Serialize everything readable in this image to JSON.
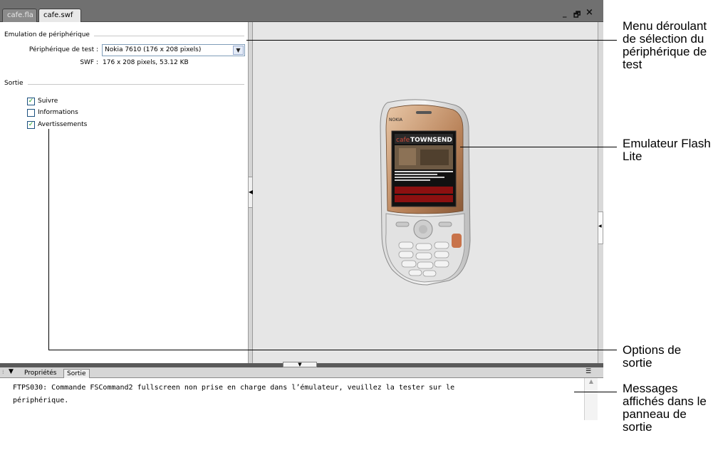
{
  "window": {
    "tabs": [
      {
        "label": "cafe.fla",
        "active": false
      },
      {
        "label": "cafe.swf",
        "active": true
      }
    ],
    "controls": {
      "minimize": "_",
      "restore": "🗗",
      "close": "×"
    }
  },
  "emulation": {
    "group_title": "Emulation de périphérique",
    "device_label": "Périphérique de test :",
    "device_value": "Nokia 7610 (176 x 208 pixels)",
    "swf_label": "SWF :",
    "swf_value": "176 x 208 pixels, 53.12 KB"
  },
  "output_options": {
    "group_title": "Sortie",
    "checkboxes": [
      {
        "label": "Suivre",
        "checked": true
      },
      {
        "label": "Informations",
        "checked": false
      },
      {
        "label": "Avertissements",
        "checked": true
      }
    ]
  },
  "phone": {
    "brand": "NOKIA",
    "screen_logo_a": "cafe",
    "screen_logo_b": "TOWNSEND"
  },
  "output_panel": {
    "tabs": [
      {
        "label": "Propriétés",
        "active": false
      },
      {
        "label": "Sortie",
        "active": true
      }
    ],
    "message": "FTPS030: Commande FSCommand2 fullscreen non prise en charge dans l’émulateur, veuillez la tester sur le\npériphérique."
  },
  "annotations": {
    "device_menu": "Menu déroulant de sélection du périphérique de test",
    "emulator": "Emulateur Flash Lite",
    "output_options": "Options de sortie",
    "output_messages": "Messages affichés dans le panneau de sortie"
  },
  "colors": {
    "tabbar": "#707070",
    "stage": "#e6e6e6",
    "check": "#21a121",
    "phone_body": "#c98f62"
  }
}
